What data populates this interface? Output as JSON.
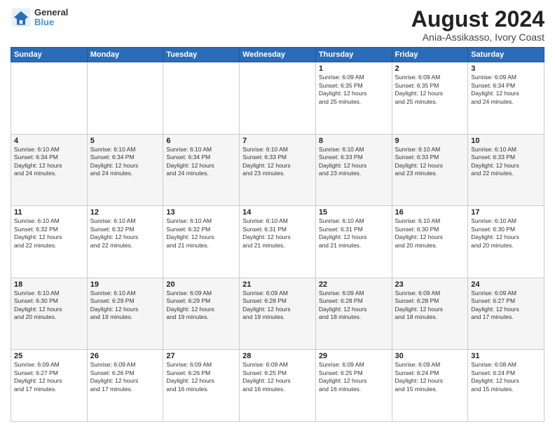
{
  "logo": {
    "line1": "General",
    "line2": "Blue"
  },
  "title": "August 2024",
  "subtitle": "Ania-Assikasso, Ivory Coast",
  "days_of_week": [
    "Sunday",
    "Monday",
    "Tuesday",
    "Wednesday",
    "Thursday",
    "Friday",
    "Saturday"
  ],
  "weeks": [
    [
      {
        "day": "",
        "info": ""
      },
      {
        "day": "",
        "info": ""
      },
      {
        "day": "",
        "info": ""
      },
      {
        "day": "",
        "info": ""
      },
      {
        "day": "1",
        "info": "Sunrise: 6:09 AM\nSunset: 6:35 PM\nDaylight: 12 hours\nand 25 minutes."
      },
      {
        "day": "2",
        "info": "Sunrise: 6:09 AM\nSunset: 6:35 PM\nDaylight: 12 hours\nand 25 minutes."
      },
      {
        "day": "3",
        "info": "Sunrise: 6:09 AM\nSunset: 6:34 PM\nDaylight: 12 hours\nand 24 minutes."
      }
    ],
    [
      {
        "day": "4",
        "info": "Sunrise: 6:10 AM\nSunset: 6:34 PM\nDaylight: 12 hours\nand 24 minutes."
      },
      {
        "day": "5",
        "info": "Sunrise: 6:10 AM\nSunset: 6:34 PM\nDaylight: 12 hours\nand 24 minutes."
      },
      {
        "day": "6",
        "info": "Sunrise: 6:10 AM\nSunset: 6:34 PM\nDaylight: 12 hours\nand 24 minutes."
      },
      {
        "day": "7",
        "info": "Sunrise: 6:10 AM\nSunset: 6:33 PM\nDaylight: 12 hours\nand 23 minutes."
      },
      {
        "day": "8",
        "info": "Sunrise: 6:10 AM\nSunset: 6:33 PM\nDaylight: 12 hours\nand 23 minutes."
      },
      {
        "day": "9",
        "info": "Sunrise: 6:10 AM\nSunset: 6:33 PM\nDaylight: 12 hours\nand 23 minutes."
      },
      {
        "day": "10",
        "info": "Sunrise: 6:10 AM\nSunset: 6:33 PM\nDaylight: 12 hours\nand 22 minutes."
      }
    ],
    [
      {
        "day": "11",
        "info": "Sunrise: 6:10 AM\nSunset: 6:32 PM\nDaylight: 12 hours\nand 22 minutes."
      },
      {
        "day": "12",
        "info": "Sunrise: 6:10 AM\nSunset: 6:32 PM\nDaylight: 12 hours\nand 22 minutes."
      },
      {
        "day": "13",
        "info": "Sunrise: 6:10 AM\nSunset: 6:32 PM\nDaylight: 12 hours\nand 21 minutes."
      },
      {
        "day": "14",
        "info": "Sunrise: 6:10 AM\nSunset: 6:31 PM\nDaylight: 12 hours\nand 21 minutes."
      },
      {
        "day": "15",
        "info": "Sunrise: 6:10 AM\nSunset: 6:31 PM\nDaylight: 12 hours\nand 21 minutes."
      },
      {
        "day": "16",
        "info": "Sunrise: 6:10 AM\nSunset: 6:30 PM\nDaylight: 12 hours\nand 20 minutes."
      },
      {
        "day": "17",
        "info": "Sunrise: 6:10 AM\nSunset: 6:30 PM\nDaylight: 12 hours\nand 20 minutes."
      }
    ],
    [
      {
        "day": "18",
        "info": "Sunrise: 6:10 AM\nSunset: 6:30 PM\nDaylight: 12 hours\nand 20 minutes."
      },
      {
        "day": "19",
        "info": "Sunrise: 6:10 AM\nSunset: 6:29 PM\nDaylight: 12 hours\nand 19 minutes."
      },
      {
        "day": "20",
        "info": "Sunrise: 6:09 AM\nSunset: 6:29 PM\nDaylight: 12 hours\nand 19 minutes."
      },
      {
        "day": "21",
        "info": "Sunrise: 6:09 AM\nSunset: 6:28 PM\nDaylight: 12 hours\nand 19 minutes."
      },
      {
        "day": "22",
        "info": "Sunrise: 6:09 AM\nSunset: 6:28 PM\nDaylight: 12 hours\nand 18 minutes."
      },
      {
        "day": "23",
        "info": "Sunrise: 6:09 AM\nSunset: 6:28 PM\nDaylight: 12 hours\nand 18 minutes."
      },
      {
        "day": "24",
        "info": "Sunrise: 6:09 AM\nSunset: 6:27 PM\nDaylight: 12 hours\nand 17 minutes."
      }
    ],
    [
      {
        "day": "25",
        "info": "Sunrise: 6:09 AM\nSunset: 6:27 PM\nDaylight: 12 hours\nand 17 minutes."
      },
      {
        "day": "26",
        "info": "Sunrise: 6:09 AM\nSunset: 6:26 PM\nDaylight: 12 hours\nand 17 minutes."
      },
      {
        "day": "27",
        "info": "Sunrise: 6:09 AM\nSunset: 6:26 PM\nDaylight: 12 hours\nand 16 minutes."
      },
      {
        "day": "28",
        "info": "Sunrise: 6:09 AM\nSunset: 6:25 PM\nDaylight: 12 hours\nand 16 minutes."
      },
      {
        "day": "29",
        "info": "Sunrise: 6:09 AM\nSunset: 6:25 PM\nDaylight: 12 hours\nand 16 minutes."
      },
      {
        "day": "30",
        "info": "Sunrise: 6:09 AM\nSunset: 6:24 PM\nDaylight: 12 hours\nand 15 minutes."
      },
      {
        "day": "31",
        "info": "Sunrise: 6:08 AM\nSunset: 6:24 PM\nDaylight: 12 hours\nand 15 minutes."
      }
    ]
  ]
}
